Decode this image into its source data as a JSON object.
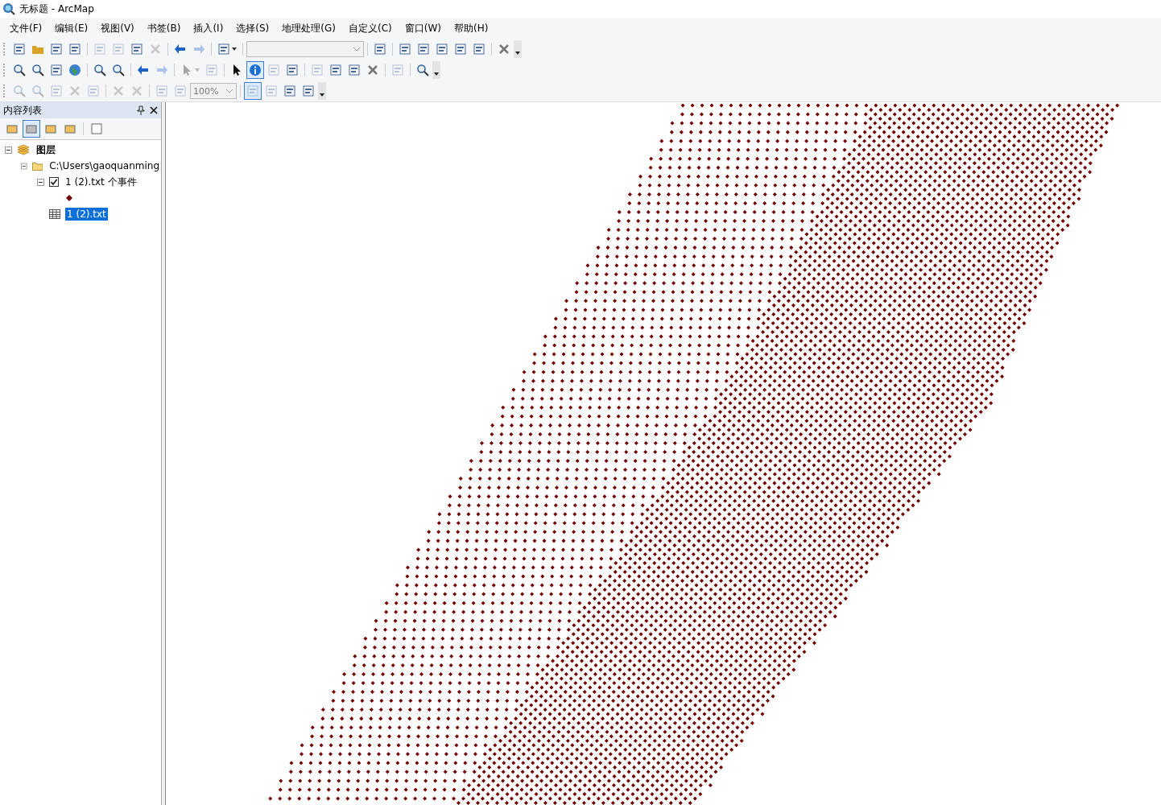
{
  "window": {
    "title": "无标题 - ArcMap"
  },
  "menu": [
    {
      "label": "文件(F)"
    },
    {
      "label": "编辑(E)"
    },
    {
      "label": "视图(V)"
    },
    {
      "label": "书签(B)"
    },
    {
      "label": "插入(I)"
    },
    {
      "label": "选择(S)"
    },
    {
      "label": "地理处理(G)"
    },
    {
      "label": "自定义(C)"
    },
    {
      "label": "窗口(W)"
    },
    {
      "label": "帮助(H)"
    }
  ],
  "toolbars": [
    {
      "items": [
        {
          "kind": "tool",
          "disabled": false
        },
        {
          "kind": "tool",
          "disabled": false
        },
        {
          "kind": "tool",
          "disabled": false
        },
        {
          "kind": "tool",
          "disabled": false
        },
        {
          "kind": "sep"
        },
        {
          "kind": "tool",
          "disabled": true
        },
        {
          "kind": "tool",
          "disabled": true
        },
        {
          "kind": "tool",
          "disabled": false
        },
        {
          "kind": "tool",
          "disabled": true
        },
        {
          "kind": "sep"
        },
        {
          "kind": "tool",
          "disabled": false
        },
        {
          "kind": "tool",
          "disabled": true
        },
        {
          "kind": "sep"
        },
        {
          "kind": "dropdown",
          "disabled": false
        },
        {
          "kind": "sep"
        },
        {
          "kind": "combo",
          "disabled": true,
          "wide": true
        },
        {
          "kind": "sep"
        },
        {
          "kind": "tool",
          "disabled": false
        },
        {
          "kind": "sep"
        },
        {
          "kind": "tool",
          "disabled": false
        },
        {
          "kind": "tool",
          "disabled": false
        },
        {
          "kind": "tool",
          "disabled": false
        },
        {
          "kind": "tool",
          "disabled": false
        },
        {
          "kind": "tool",
          "disabled": false
        },
        {
          "kind": "sep"
        },
        {
          "kind": "tool",
          "disabled": false
        },
        {
          "kind": "more"
        }
      ]
    },
    {
      "items": [
        {
          "kind": "tool",
          "disabled": false
        },
        {
          "kind": "tool",
          "disabled": false
        },
        {
          "kind": "tool",
          "disabled": false
        },
        {
          "kind": "tool",
          "disabled": false
        },
        {
          "kind": "sep"
        },
        {
          "kind": "tool",
          "disabled": false
        },
        {
          "kind": "tool",
          "disabled": false
        },
        {
          "kind": "sep"
        },
        {
          "kind": "tool",
          "disabled": false
        },
        {
          "kind": "tool",
          "disabled": true
        },
        {
          "kind": "sep"
        },
        {
          "kind": "dropdown",
          "disabled": true
        },
        {
          "kind": "tool",
          "disabled": true
        },
        {
          "kind": "sep"
        },
        {
          "kind": "tool",
          "disabled": false
        },
        {
          "kind": "tool",
          "disabled": false,
          "selected": true
        },
        {
          "kind": "tool",
          "disabled": true
        },
        {
          "kind": "tool",
          "disabled": false
        },
        {
          "kind": "sep"
        },
        {
          "kind": "tool",
          "disabled": true
        },
        {
          "kind": "tool",
          "disabled": false
        },
        {
          "kind": "tool",
          "disabled": false
        },
        {
          "kind": "tool",
          "disabled": false
        },
        {
          "kind": "sep"
        },
        {
          "kind": "tool",
          "disabled": true
        },
        {
          "kind": "sep"
        },
        {
          "kind": "tool",
          "disabled": false
        },
        {
          "kind": "more"
        }
      ]
    },
    {
      "items": [
        {
          "kind": "tool",
          "disabled": true
        },
        {
          "kind": "tool",
          "disabled": true
        },
        {
          "kind": "tool",
          "disabled": true
        },
        {
          "kind": "tool",
          "disabled": true
        },
        {
          "kind": "tool",
          "disabled": true
        },
        {
          "kind": "sep"
        },
        {
          "kind": "tool",
          "disabled": true
        },
        {
          "kind": "tool",
          "disabled": true
        },
        {
          "kind": "sep"
        },
        {
          "kind": "tool",
          "disabled": true
        },
        {
          "kind": "tool",
          "disabled": true
        },
        {
          "kind": "combo",
          "disabled": true,
          "value": "100%"
        },
        {
          "kind": "sep"
        },
        {
          "kind": "tool",
          "disabled": true,
          "selected": true
        },
        {
          "kind": "tool",
          "disabled": true
        },
        {
          "kind": "tool",
          "disabled": false
        },
        {
          "kind": "tool",
          "disabled": false
        },
        {
          "kind": "more"
        }
      ]
    }
  ],
  "toc": {
    "title": "内容列表",
    "tabs": [
      {
        "selected": false
      },
      {
        "selected": true
      },
      {
        "selected": false
      },
      {
        "selected": false
      },
      {
        "selected": false
      }
    ],
    "tree": [
      {
        "kind": "group",
        "label": "图层",
        "expanded": true,
        "children": [
          {
            "kind": "folder",
            "label": "C:\\Users\\gaoquanming",
            "expanded": true,
            "children": [
              {
                "kind": "layer",
                "label": "1 (2).txt 个事件",
                "expanded": true,
                "checked": true,
                "symbol": {
                  "color": "#730000"
                }
              },
              {
                "kind": "table",
                "label": "1 (2).txt",
                "selected": true
              }
            ]
          }
        ]
      }
    ]
  }
}
